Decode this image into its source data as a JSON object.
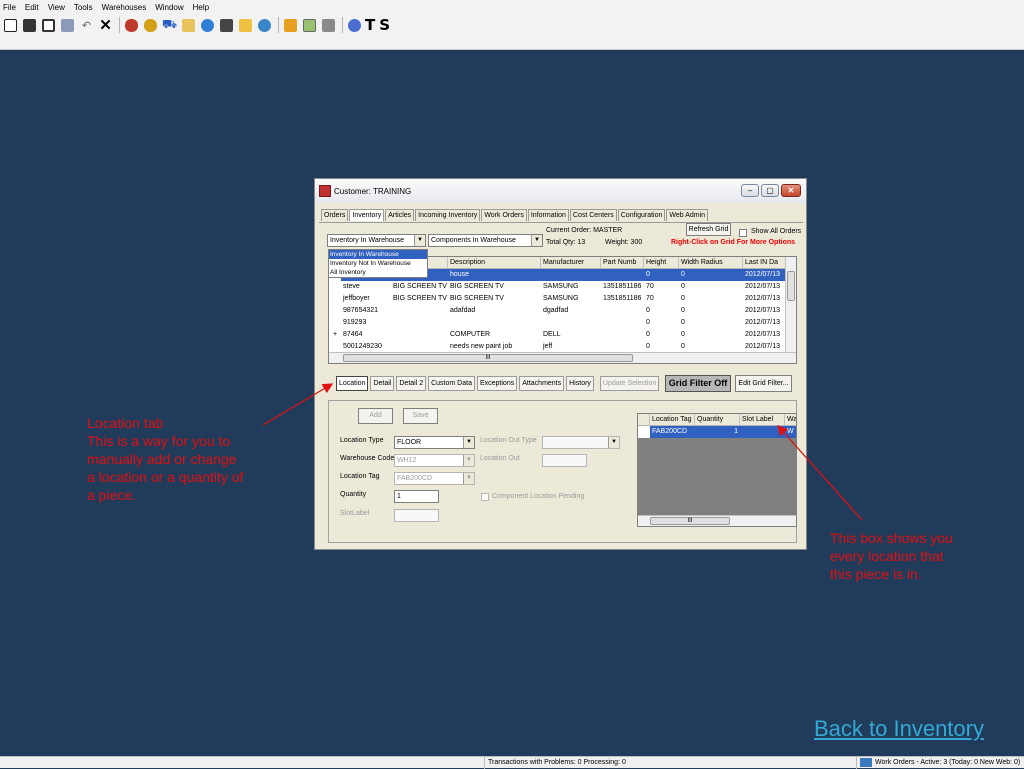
{
  "menu": [
    "File",
    "Edit",
    "View",
    "Tools",
    "Warehouses",
    "Window",
    "Help"
  ],
  "toolbar": {
    "icons": [
      "new-document-icon",
      "pin-icon",
      "copy-icon",
      "save-icon",
      "undo-icon",
      "delete-icon",
      "users-icon",
      "money-icon",
      "cart-icon",
      "folder-icon",
      "globe-icon",
      "puzzle-icon",
      "folder-open-icon",
      "network-icon",
      "edit-icon",
      "image-icon",
      "component-icon",
      "info-icon"
    ],
    "text_buttons": [
      "T",
      "S"
    ]
  },
  "window": {
    "title": "Customer: TRAINING",
    "buttons": [
      "–",
      "▢",
      "✕"
    ],
    "tabs": [
      "Orders",
      "Inventory",
      "Articles",
      "Incoming Inventory",
      "Work Orders",
      "Information",
      "Cost Centers",
      "Configuration",
      "Web Admin"
    ],
    "active_tab": "Inventory",
    "inventory_select": "Inventory In Warehouse",
    "inventory_options": [
      "Inventory In Warehouse",
      "Inventory Not In Warehouse",
      "All Inventory"
    ],
    "components_select": "Components In Warehouse",
    "current_order": "Current Order:  MASTER",
    "total_qty": "Total Qty:  13",
    "weight": "Weight:  300",
    "refresh_button": "Refresh Grid",
    "show_all_orders": "Show All Orders",
    "right_click_hint": "Right-Click on Grid For More Options"
  },
  "grid": {
    "columns": [
      "",
      "",
      "umber",
      "Description",
      "Manufacturer",
      "Part Numb",
      "Height",
      "Width Radius",
      "Last IN Da"
    ],
    "rows": [
      {
        "expand": "",
        "name": "",
        "number": "E",
        "description": "house",
        "manufacturer": "",
        "part": "",
        "height": "0",
        "width": "0",
        "date": "2012/07/13",
        "selected": true
      },
      {
        "expand": "",
        "name": "steve",
        "number": "BIG SCREEN TV",
        "description": "BIG SCREEN TV",
        "manufacturer": "SAMSUNG",
        "part": "1351851186",
        "height": "70",
        "width": "0",
        "date": "2012/07/13"
      },
      {
        "expand": "",
        "name": "jeffboyer",
        "number": "BIG SCREEN TV",
        "description": "BIG SCREEN TV",
        "manufacturer": "SAMSUNG",
        "part": "1351851186",
        "height": "70",
        "width": "0",
        "date": "2012/07/13"
      },
      {
        "expand": "",
        "name": "987654321",
        "number": "",
        "description": "adafdad",
        "manufacturer": "dgadfad",
        "part": "",
        "height": "0",
        "width": "0",
        "date": "2012/07/13"
      },
      {
        "expand": "",
        "name": "919293",
        "number": "",
        "description": "",
        "manufacturer": "",
        "part": "",
        "height": "0",
        "width": "0",
        "date": "2012/07/13"
      },
      {
        "expand": "+",
        "name": "87464",
        "number": "",
        "description": "COMPUTER",
        "manufacturer": "DELL",
        "part": "",
        "height": "0",
        "width": "0",
        "date": "2012/07/13"
      },
      {
        "expand": "",
        "name": "5001249230",
        "number": "",
        "description": "needs new paint job",
        "manufacturer": "jeff",
        "part": "",
        "height": "0",
        "width": "0",
        "date": "2012/07/13"
      }
    ],
    "hscroll_thumb": "III"
  },
  "bottom_tabs": [
    "Location",
    "Detail",
    "Detail 2",
    "Custom Data",
    "Exceptions",
    "Attachments",
    "History"
  ],
  "active_bottom_tab": "Location",
  "update_selection": "Update Selection",
  "grid_filter": "Grid Filter Off",
  "edit_grid_filter": "Edit Grid Filter...",
  "location_panel": {
    "add": "Add",
    "save": "Save",
    "location_type_label": "Location Type",
    "location_type": "FLOOR",
    "warehouse_code_label": "Warehouse Code",
    "warehouse_code": "WH12",
    "location_tag_label": "Location Tag",
    "location_tag": "FAB200CD",
    "quantity_label": "Quantity",
    "quantity": "1",
    "slotlabel_label": "SlotLabel",
    "location_out_type_label": "Location Out Type",
    "location_out_label": "Location Out",
    "component_pending": "Component Location Pending",
    "loc_grid_columns": [
      "Location Tag",
      "Quantity",
      "Slot Label",
      "Wa"
    ],
    "loc_grid_row": {
      "tag": "FAB200CD",
      "quantity": "1",
      "slot": "",
      "wa": "W"
    },
    "loc_hscroll_thumb": "III"
  },
  "annotations": {
    "left": [
      "Location tab",
      "This is a way for you to",
      "manually add or change",
      "a location or a quantity of",
      "a piece."
    ],
    "right": [
      "This box shows you",
      "every location that",
      "this piece is in."
    ]
  },
  "link": "Back to Inventory",
  "status": {
    "transactions": "Transactions with Problems: 0  Processing: 0",
    "work_orders": "Work Orders - Active: 3  (Today: 0  New Web: 0)"
  },
  "colors": {
    "background": "#213b5b",
    "annotation": "#e01010",
    "link": "#33a9d6",
    "selection": "#3161c0"
  }
}
